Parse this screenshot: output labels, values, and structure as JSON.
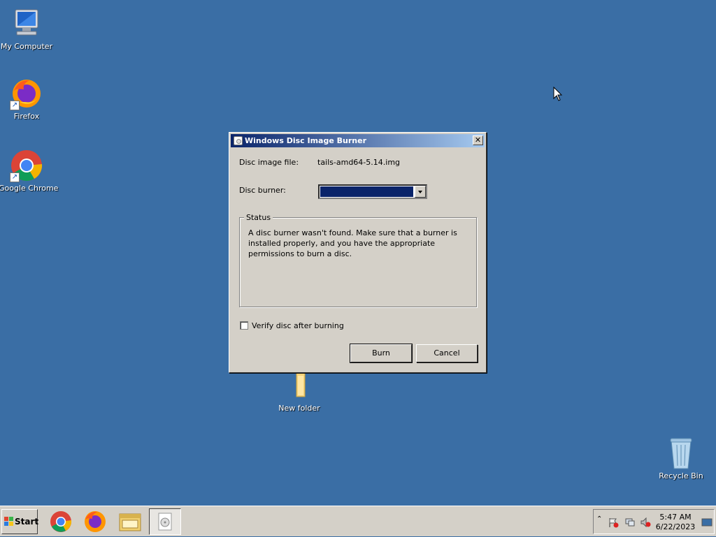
{
  "desktop": {
    "icons": [
      {
        "label": "My Computer"
      },
      {
        "label": "Firefox"
      },
      {
        "label": "Google Chrome"
      },
      {
        "label": "New folder"
      },
      {
        "label": "Recycle Bin"
      }
    ]
  },
  "dialog": {
    "title": "Windows Disc Image Burner",
    "close_label": "✕",
    "disc_image_label": "Disc image file:",
    "disc_image_value": "tails-amd64-5.14.img",
    "disc_burner_label": "Disc burner:",
    "status_label": "Status",
    "status_text": "A disc burner wasn't found. Make sure that a burner is installed properly, and you have the appropriate permissions to burn a disc.",
    "verify_label": "Verify disc after burning",
    "verify_checked": false,
    "burn_label": "Burn",
    "cancel_label": "Cancel"
  },
  "taskbar": {
    "start_label": "Start",
    "pinned": [
      {
        "icon": "chrome-icon"
      },
      {
        "icon": "firefox-icon"
      },
      {
        "icon": "file-explorer-icon"
      },
      {
        "icon": "disc-burner-icon",
        "active": true
      }
    ],
    "tray": {
      "time": "5:47 AM",
      "date": "6/22/2023"
    }
  },
  "colors": {
    "desktop": "#3a6ea5",
    "titlebar_start": "#0a246a",
    "titlebar_end": "#a6caf0",
    "dialog_face": "#d4d0c8"
  }
}
